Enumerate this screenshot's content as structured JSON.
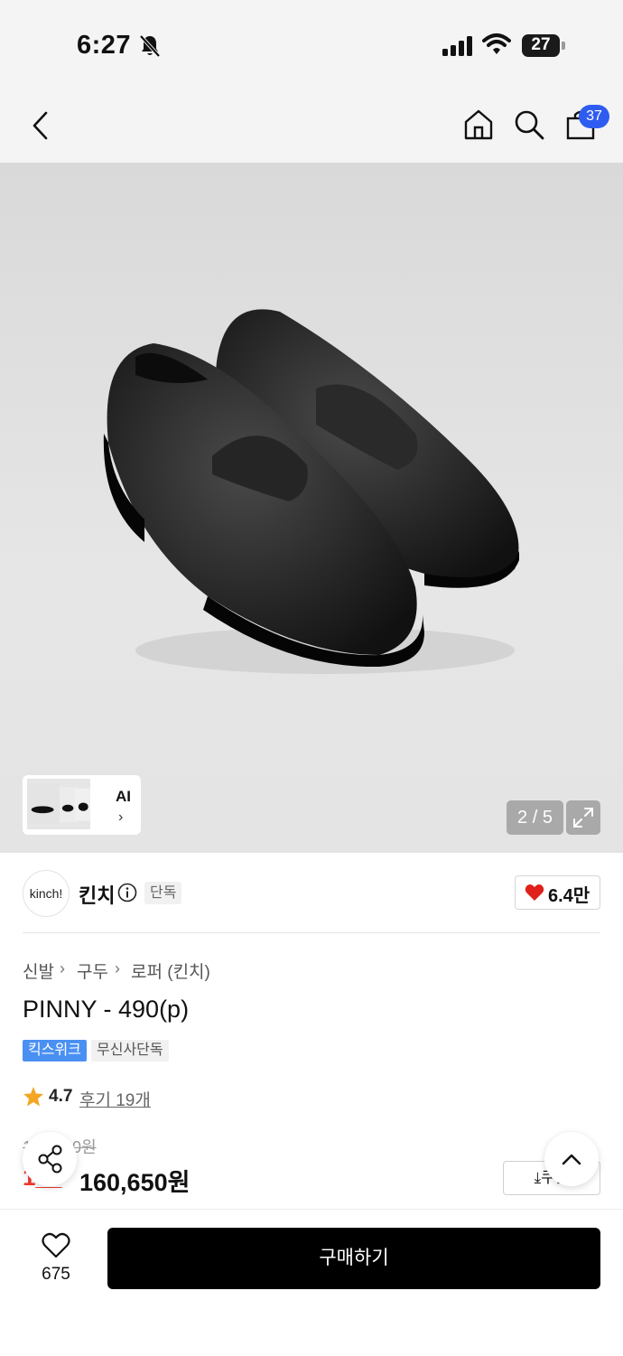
{
  "status_bar": {
    "time": "6:27",
    "battery": "27"
  },
  "header": {
    "cart_count": "37"
  },
  "gallery": {
    "thumb_label": "AI",
    "thumb_chevron": "›",
    "counter": "2 / 5"
  },
  "brand": {
    "logo_text": "kinch!",
    "name": "킨치",
    "exclusive": "단독",
    "likes": "6.4만"
  },
  "breadcrumb": [
    "신발",
    "구두",
    "로퍼 (킨치)"
  ],
  "product": {
    "title": "PINNY - 490(p)",
    "tags": [
      "킥스위크",
      "무신사단독"
    ],
    "rating": "4.7",
    "reviews": "후기 19개",
    "original_price": "1__,_00원",
    "discount": "1__",
    "sale_price": "160,650원",
    "coupon_label": "⤓쿠폰"
  },
  "bottom_bar": {
    "wish_count": "675",
    "buy_label": "구매하기"
  },
  "colors": {
    "accent_blue": "#2f5cf0",
    "tag_blue": "#4a90f2",
    "discount_red": "#f03a2e",
    "like_red": "#e0201a"
  },
  "icons": [
    "back-icon",
    "home-icon",
    "search-icon",
    "cart-icon",
    "expand-icon",
    "info-icon",
    "heart-icon",
    "star-icon",
    "share-icon",
    "chevron-up-icon"
  ]
}
